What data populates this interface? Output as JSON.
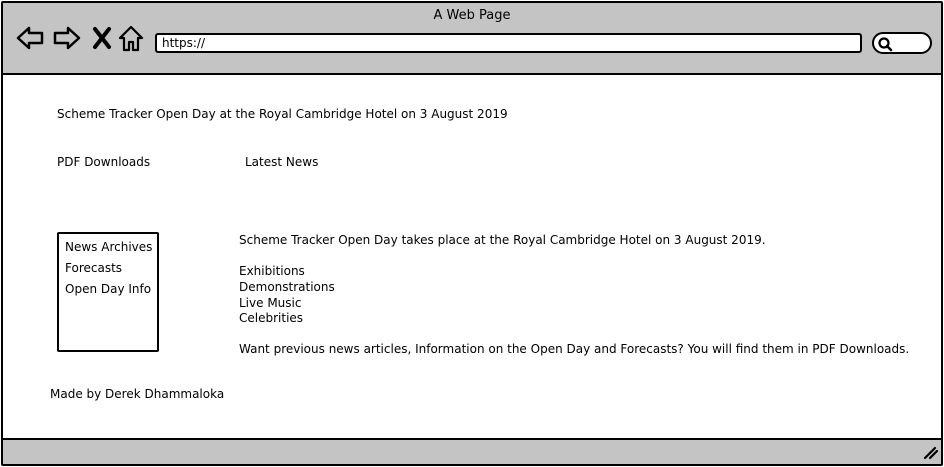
{
  "window": {
    "title": "A Web Page"
  },
  "toolbar": {
    "url": "https://",
    "icons": [
      "back-arrow-icon",
      "forward-arrow-icon",
      "close-x-icon",
      "home-icon",
      "search-icon"
    ]
  },
  "header": {
    "headline": "Scheme Tracker Open Day at the Royal Cambridge Hotel on 3 August 2019"
  },
  "nav": {
    "pdf_downloads": "PDF Downloads",
    "latest_news": "Latest News"
  },
  "sidebar": {
    "items": [
      {
        "label": "News Archives"
      },
      {
        "label": "Forecasts"
      },
      {
        "label": "Open Day Info"
      }
    ]
  },
  "main": {
    "intro": "Scheme Tracker Open Day takes place at the Royal Cambridge Hotel on 3 August 2019.",
    "highlights": [
      "Exhibitions",
      "Demonstrations",
      "Live Music",
      "Celebrities"
    ],
    "closing": "Want previous news articles, Information on the Open Day and Forecasts? You will find them in PDF Downloads."
  },
  "footer": {
    "credit": "Made by Derek Dhammaloka"
  },
  "colors": {
    "chrome": "#c4c4c4",
    "stroke": "#000000",
    "background": "#ffffff"
  }
}
